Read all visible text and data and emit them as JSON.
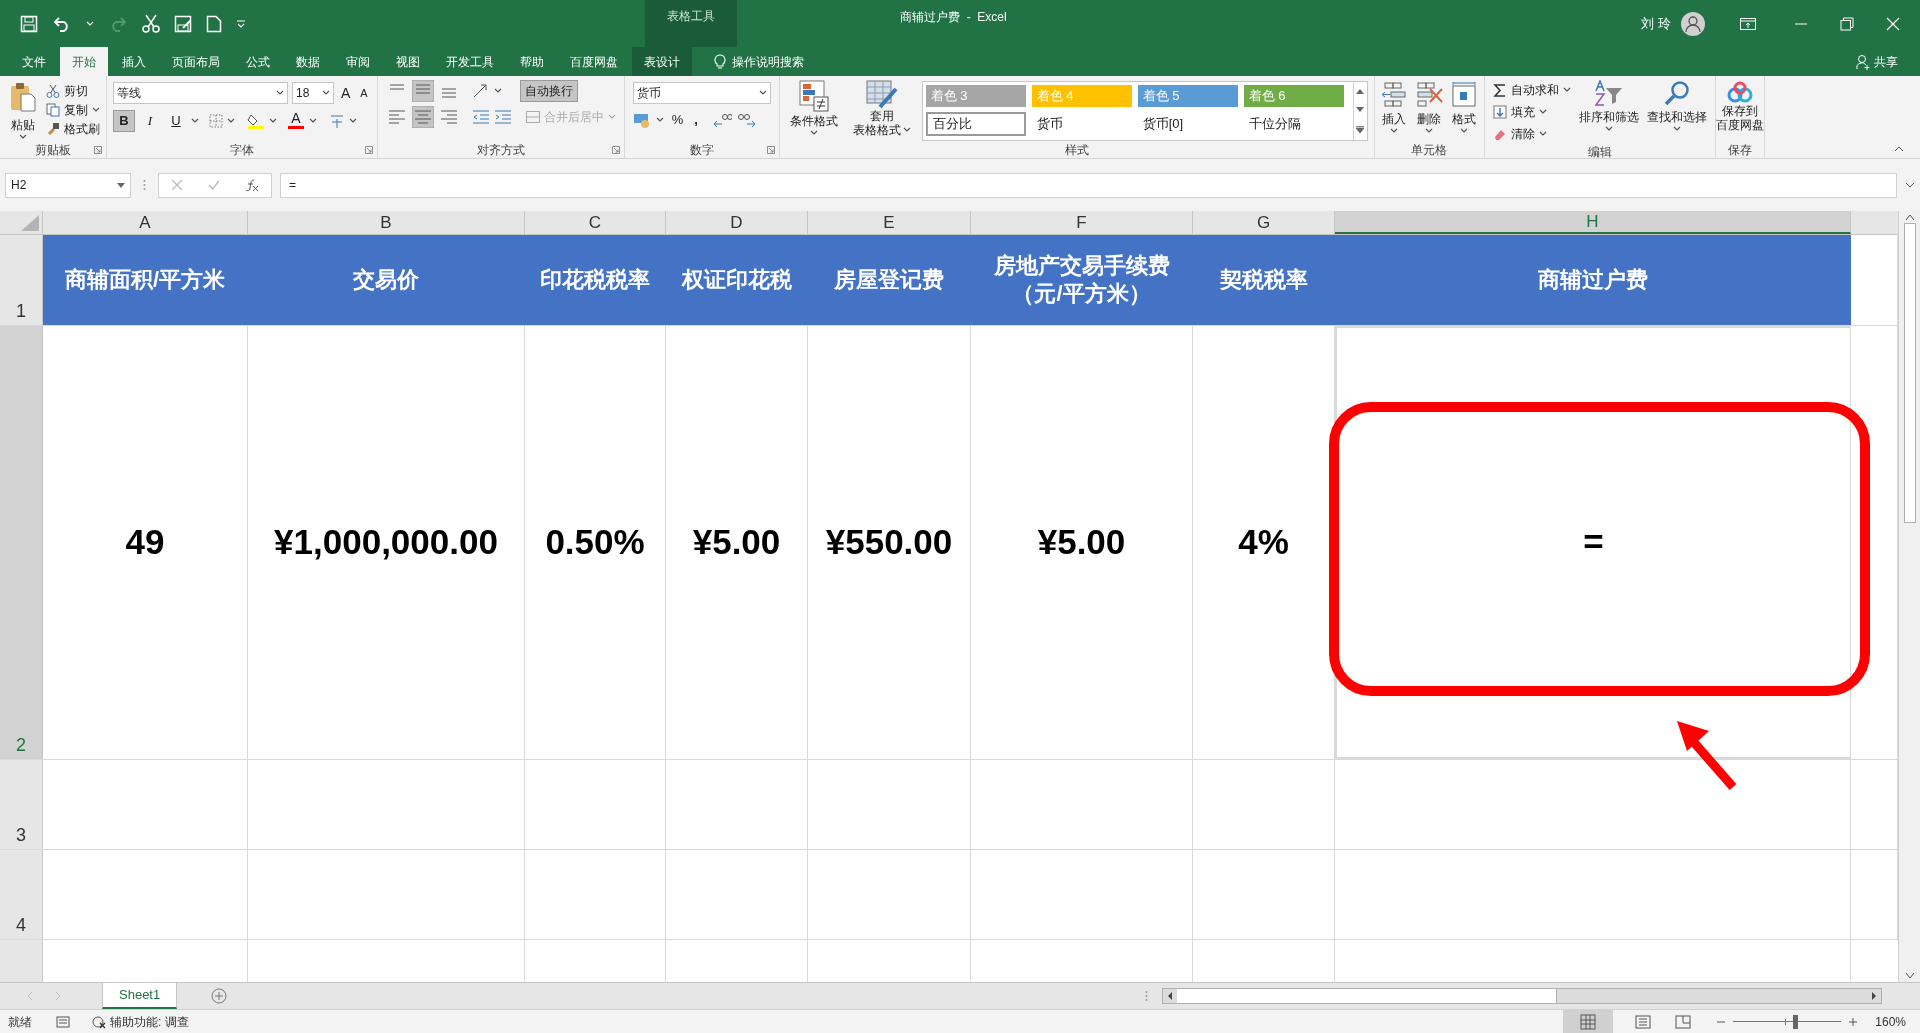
{
  "context_tab_group": "表格工具",
  "window_title": "商辅过户费  -  Excel",
  "user": "刘 玲",
  "menu_tabs": [
    {
      "label": "文件",
      "selected": false
    },
    {
      "label": "开始",
      "selected": true
    },
    {
      "label": "插入",
      "selected": false
    },
    {
      "label": "页面布局",
      "selected": false
    },
    {
      "label": "公式",
      "selected": false
    },
    {
      "label": "数据",
      "selected": false
    },
    {
      "label": "审阅",
      "selected": false
    },
    {
      "label": "视图",
      "selected": false
    },
    {
      "label": "开发工具",
      "selected": false
    },
    {
      "label": "帮助",
      "selected": false
    },
    {
      "label": "百度网盘",
      "selected": false
    },
    {
      "label": "表设计",
      "selected": false
    }
  ],
  "tell_me": "操作说明搜索",
  "share": "共享",
  "clipboard": {
    "paste": "粘贴",
    "items": [
      "剪切",
      "复制",
      "格式刷"
    ],
    "label": "剪贴板"
  },
  "font": {
    "name": "等线",
    "size": "18",
    "grow": "A",
    "shrink": "A",
    "styles": [
      {
        "label": "B",
        "selected": true
      },
      {
        "label": "I",
        "selected": false
      },
      {
        "label": "U",
        "selected": false
      }
    ],
    "color_label": "A",
    "label": "字体"
  },
  "alignment": {
    "wrap": {
      "label": "自动换行",
      "selected": true
    },
    "merge": {
      "label": "合并后居中",
      "disabled": true
    },
    "label": "对齐方式"
  },
  "number": {
    "format": "货币",
    "percent": "%",
    "comma": ",",
    "label": "数字"
  },
  "styles": {
    "conditional": "条件格式",
    "table_format": [
      "套用",
      "表格格式"
    ],
    "gallery": [
      {
        "label": "着色 3",
        "color": "#a5a5a5"
      },
      {
        "label": "着色 4",
        "color": "#ffc000"
      },
      {
        "label": "着色 5",
        "color": "#5b9bd5"
      },
      {
        "label": "着色 6",
        "color": "#70ad47"
      },
      {
        "label": "百分比",
        "selected": true
      },
      {
        "label": "货币",
        "selected": false
      },
      {
        "label": "货币[0]",
        "selected": false
      },
      {
        "label": "千位分隔",
        "selected": false
      }
    ],
    "label": "样式"
  },
  "cells": {
    "items": [
      "插入",
      "删除",
      "格式"
    ],
    "label": "单元格"
  },
  "editing": {
    "autosum": "自动求和",
    "fill": "填充",
    "clear": "清除",
    "sort": "排序和筛选",
    "find": "查找和选择",
    "label": "编辑"
  },
  "save": {
    "items": [
      "保存到",
      "百度网盘"
    ],
    "label": "保存"
  },
  "name_box": "H2",
  "formula": "=",
  "columns": [
    {
      "label": "A",
      "selected": false
    },
    {
      "label": "B",
      "selected": false
    },
    {
      "label": "C",
      "selected": false
    },
    {
      "label": "D",
      "selected": false
    },
    {
      "label": "E",
      "selected": false
    },
    {
      "label": "F",
      "selected": false
    },
    {
      "label": "G",
      "selected": false
    },
    {
      "label": "H",
      "selected": true
    }
  ],
  "rows": [
    {
      "header": "1",
      "selected": false,
      "kind": "header",
      "cells": [
        "商辅面积/平方米",
        "交易价",
        "印花税税率",
        "权证印花税",
        "房屋登记费",
        [
          "房地产交易手续费",
          "（元/平方米）"
        ],
        "契税税率",
        "商辅过户费"
      ]
    },
    {
      "header": "2",
      "selected": true,
      "kind": "data",
      "cells": [
        "49",
        "¥1,000,000.00",
        "0.50%",
        "¥5.00",
        "¥550.00",
        "¥5.00",
        "4%",
        "="
      ]
    },
    {
      "header": "3",
      "selected": false,
      "kind": "empty",
      "cells": []
    },
    {
      "header": "4",
      "selected": false,
      "kind": "empty",
      "cells": []
    }
  ],
  "sheet_tabs": [
    {
      "label": "Sheet1",
      "selected": true
    }
  ],
  "status": {
    "ready": "就绪",
    "accessibility": "辅助功能: 调查",
    "zoom_slider": {
      "level": 0.58
    },
    "zoom": "160%"
  }
}
